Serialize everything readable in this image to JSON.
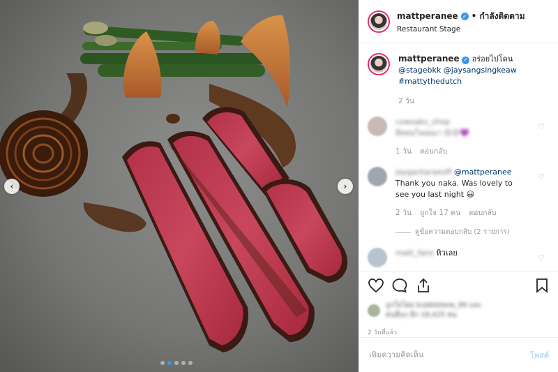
{
  "post": {
    "username": "mattperanee",
    "follow_sep": "•",
    "follow_status": "กำลังติดตาม",
    "location": "Restaurant Stage"
  },
  "caption": {
    "username": "mattperanee",
    "text": "อร่อยไปโดน",
    "mention1": "@stagebkk",
    "mention2": "@jaysangsingkeaw",
    "hashtag": "#mattythedutch",
    "time": "2 วัน"
  },
  "comments": [
    {
      "user": "cowsaks_shop",
      "text": "ติดต่อโฆษณา 😍😍💜",
      "time": "1 วัน",
      "reply": "ตอบกลับ"
    },
    {
      "user": "jaygantaraeoff",
      "mention": "@mattperanee",
      "text": "Thank you naka. Was lovely to see you last night 😃",
      "time": "2 วัน",
      "likes": "ถูกใจ 17 คน",
      "reply": "ตอบกลับ",
      "view_replies": "ดูข้อความตอบกลับ (2 รายการ)"
    },
    {
      "user": "matt_fans",
      "text": "หิวเลย"
    }
  ],
  "liked_by": {
    "line1": "ถูกใจโดย bubblebew_99 และ",
    "line2": "คนอื่นๆ อีก 18,425 คน"
  },
  "timestamp": "2 วันที่แล้ว",
  "add_comment": {
    "placeholder": "เพิ่มความคิดเห็น",
    "post_label": "โพสต์"
  },
  "colors": {
    "accent": "#3897f0",
    "link": "#003569",
    "muted": "#999999",
    "post_disabled": "#b2dffc"
  }
}
